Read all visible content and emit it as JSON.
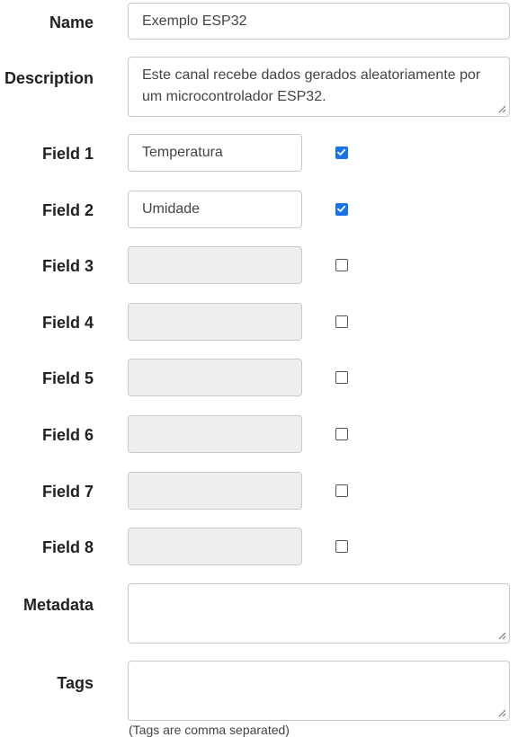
{
  "name": {
    "label": "Name",
    "value": "Exemplo ESP32"
  },
  "description": {
    "label": "Description",
    "value": "Este canal recebe dados gerados aleatoriamente por um microcontrolador ESP32."
  },
  "fields": [
    {
      "label": "Field 1",
      "value": "Temperatura",
      "enabled": true
    },
    {
      "label": "Field 2",
      "value": "Umidade",
      "enabled": true
    },
    {
      "label": "Field 3",
      "value": "",
      "enabled": false
    },
    {
      "label": "Field 4",
      "value": "",
      "enabled": false
    },
    {
      "label": "Field 5",
      "value": "",
      "enabled": false
    },
    {
      "label": "Field 6",
      "value": "",
      "enabled": false
    },
    {
      "label": "Field 7",
      "value": "",
      "enabled": false
    },
    {
      "label": "Field 8",
      "value": "",
      "enabled": false
    }
  ],
  "metadata": {
    "label": "Metadata",
    "value": ""
  },
  "tags": {
    "label": "Tags",
    "value": "",
    "hint": "(Tags are comma separated)"
  },
  "colors": {
    "checkbox_checked": "#1a73e8",
    "disabled_bg": "#eeeeee"
  }
}
